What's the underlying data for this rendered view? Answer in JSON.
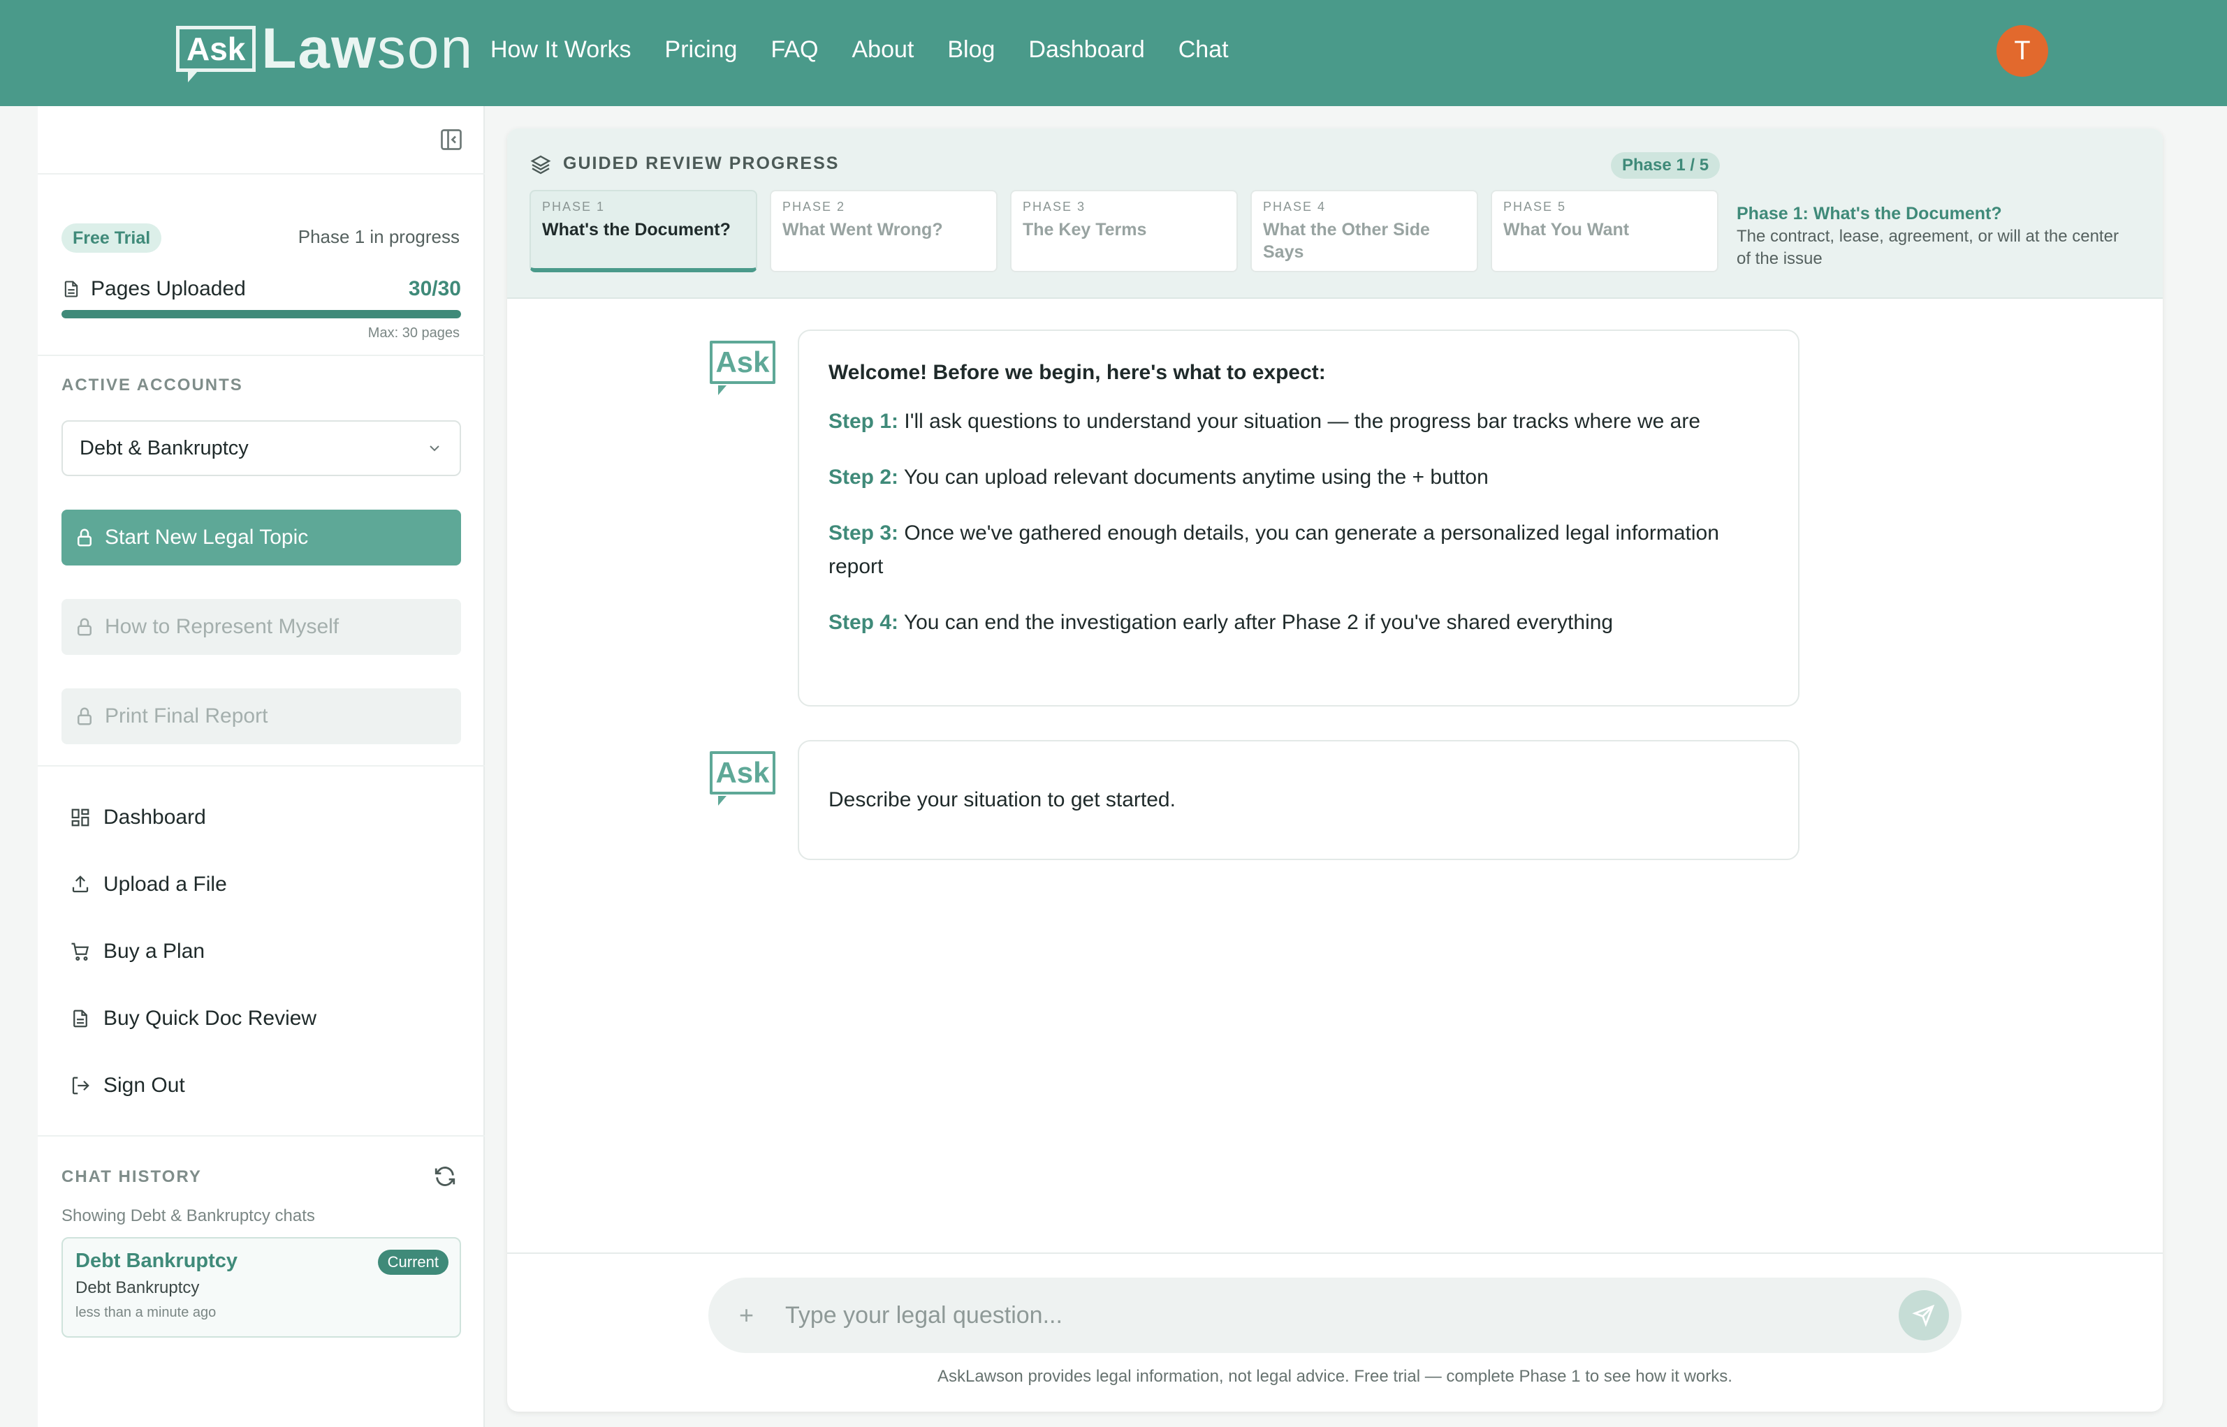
{
  "brand": {
    "ask": "Ask",
    "law": "Law",
    "son": "son"
  },
  "nav": {
    "items": [
      "How It Works",
      "Pricing",
      "FAQ",
      "About",
      "Blog",
      "Dashboard",
      "Chat"
    ]
  },
  "user": {
    "avatar_initial": "T",
    "avatar_color": "#e2692d"
  },
  "colors": {
    "brand": "#4a9a8a",
    "accent": "#3f8a79"
  },
  "sidebar": {
    "trial_badge": "Free Trial",
    "phase_status": "Phase 1 in progress",
    "pages_label": "Pages Uploaded",
    "pages_count": "30/30",
    "pages_progress": 1.0,
    "max_pages": "Max: 30 pages",
    "active_accounts_label": "ACTIVE ACCOUNTS",
    "account_selected": "Debt & Bankruptcy",
    "start_topic": "Start New Legal Topic",
    "represent_myself": "How to Represent Myself",
    "print_report": "Print Final Report",
    "menu": {
      "dashboard": "Dashboard",
      "upload": "Upload a File",
      "buy_plan": "Buy a Plan",
      "quick_review": "Buy Quick Doc Review",
      "sign_out": "Sign Out"
    },
    "chat_history_label": "CHAT HISTORY",
    "history_sub": "Showing Debt & Bankruptcy chats",
    "history_item": {
      "title": "Debt Bankruptcy",
      "subtitle": "Debt Bankruptcy",
      "time": "less than a minute ago",
      "badge": "Current"
    }
  },
  "progress": {
    "title": "GUIDED REVIEW PROGRESS",
    "phase_pill": "Phase 1 / 5",
    "phases": [
      {
        "num": "PHASE 1",
        "name": "What's the Document?"
      },
      {
        "num": "PHASE 2",
        "name": "What Went Wrong?"
      },
      {
        "num": "PHASE 3",
        "name": "The Key Terms"
      },
      {
        "num": "PHASE 4",
        "name": "What the Other Side Says"
      },
      {
        "num": "PHASE 5",
        "name": "What You Want"
      }
    ],
    "current_title": "Phase 1: What's the Document?",
    "current_desc": "The contract, lease, agreement, or will at the center of the issue"
  },
  "chat": {
    "ask_label": "Ask",
    "welcome_title": "Welcome! Before we begin, here's what to expect:",
    "steps": [
      {
        "label": "Step 1:",
        "text": "I'll ask questions to understand your situation — the progress bar tracks where we are"
      },
      {
        "label": "Step 2:",
        "text": "You can upload relevant documents anytime using the + button"
      },
      {
        "label": "Step 3:",
        "text": "Once we've gathered enough details, you can generate a personalized legal information report"
      },
      {
        "label": "Step 4:",
        "text": "You can end the investigation early after Phase 2 if you've shared everything"
      }
    ],
    "second_message": "Describe your situation to get started."
  },
  "input": {
    "plus": "+",
    "placeholder": "Type your legal question...",
    "disclaimer": "AskLawson provides legal information, not legal advice. Free trial — complete Phase 1 to see how it works."
  }
}
